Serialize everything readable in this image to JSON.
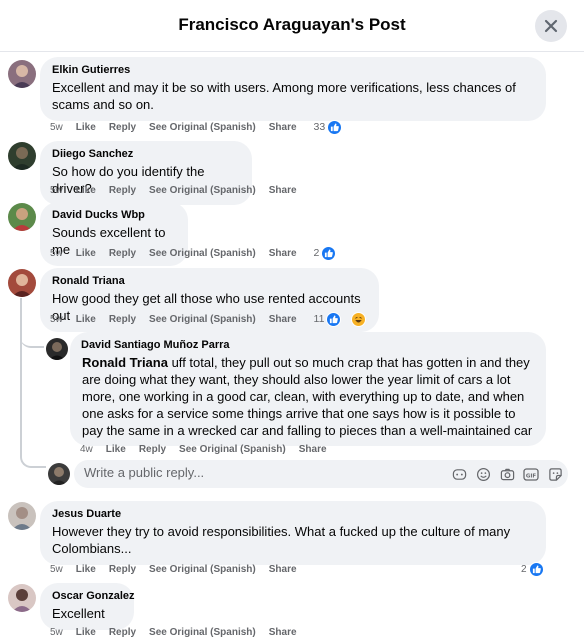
{
  "header": {
    "title": "Francisco Araguayan's Post"
  },
  "actions_labels": {
    "like": "Like",
    "reply": "Reply",
    "see_original": "See Original (Spanish)",
    "share": "Share"
  },
  "comments": [
    {
      "author": "Elkin Gutierres",
      "text": "Excellent and may it be so with users. Among more verifications, less chances of scams and so on.",
      "time": "5w",
      "reactions": "33",
      "reaction_icons": [
        "like-icon"
      ]
    },
    {
      "author": "Diiego Sanchez",
      "text": "So how do you identify the driver?",
      "time": "5w"
    },
    {
      "author": "David Ducks Wbp",
      "text": "Sounds excellent to me",
      "time": "5w",
      "reactions": "2",
      "reaction_icons": [
        "like-icon"
      ]
    },
    {
      "author": "Ronald Triana",
      "text": "How good they get all those who use rented accounts out",
      "time": "5w",
      "reactions": "11",
      "reaction_icons": [
        "like-icon",
        "haha-icon"
      ]
    },
    {
      "author": "Jesus Duarte",
      "text": "However they try to avoid responsibilities. What a fucked up the culture of many Colombians...",
      "time": "5w",
      "reactions": "2",
      "reaction_icons": [
        "like-icon"
      ]
    },
    {
      "author": "Oscar Gonzalez",
      "text": "Excellent",
      "time": "5w"
    }
  ],
  "reply": {
    "author": "David Santiago Muñoz Parra",
    "mention": "Ronald Triana",
    "text": " uff total, they pull out so much crap that has gotten in and they are doing what they want, they should also lower the year limit of cars a lot more, one working in a good car, clean, with everything up to date, and when one asks for a service some things arrive that one says how is it possible to pay the same in a wrecked car and falling to pieces than a well-maintained car",
    "time": "4w"
  },
  "reply_box": {
    "placeholder": "Write a public reply...",
    "icons": [
      "avatar-icon",
      "sticker-face-icon",
      "emoji-icon",
      "camera-icon",
      "gif-icon",
      "sticker-icon"
    ]
  },
  "colors": {
    "bubble": "#f0f2f5",
    "like_blue": "#1877f2",
    "meta_gray": "#65676b",
    "haha_yellow": "#f7b125"
  }
}
